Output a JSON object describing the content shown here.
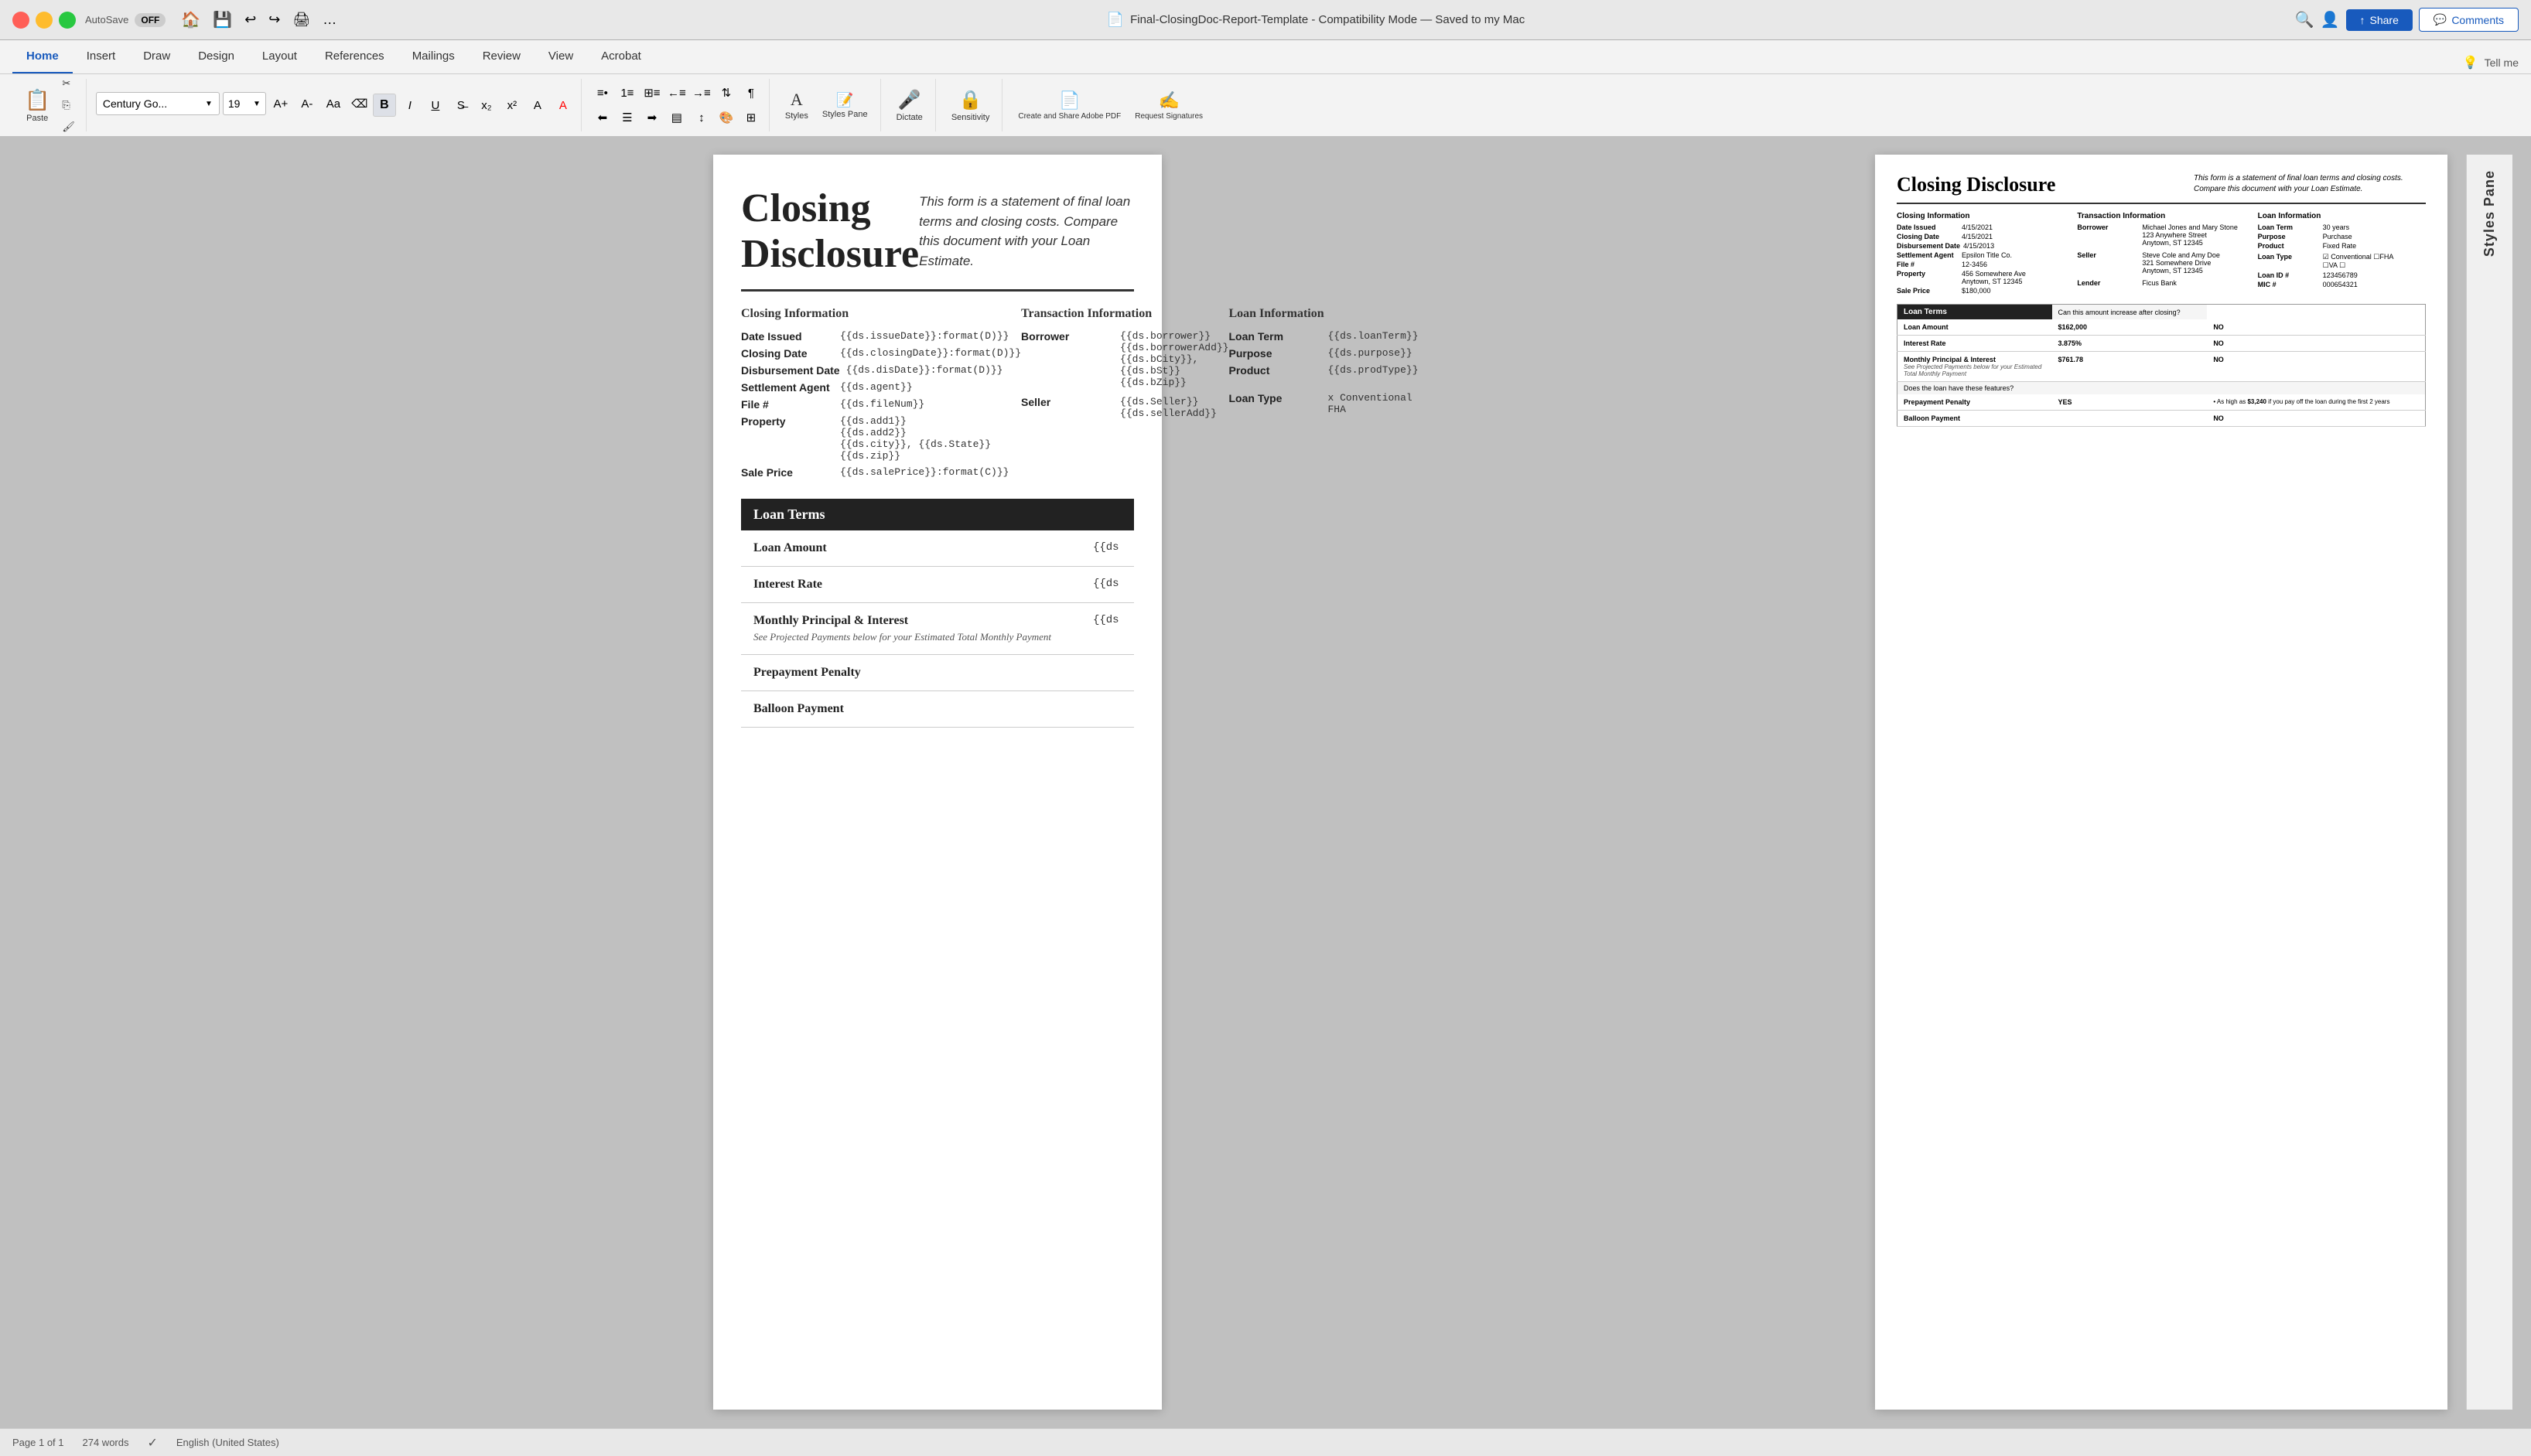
{
  "app": {
    "title": "Final-ClosingDoc-Report-Template",
    "mode": "Compatibility Mode",
    "save_status": "Saved to my Mac"
  },
  "titlebar": {
    "autosave_label": "AutoSave",
    "autosave_state": "OFF",
    "title": "Final-ClosingDoc-Report-Template  -  Compatibility Mode  —  Saved to my Mac"
  },
  "ribbon": {
    "tabs": [
      "Home",
      "Insert",
      "Draw",
      "Design",
      "Layout",
      "References",
      "Mailings",
      "Review",
      "View",
      "Acrobat"
    ],
    "active_tab": "Home",
    "font_name": "Century Go...",
    "font_size": "19",
    "share_label": "Share",
    "comments_label": "Comments",
    "tell_me": "Tell me",
    "buttons": {
      "paste": "Paste",
      "styles": "Styles",
      "styles_pane": "Styles Pane",
      "dictate": "Dictate",
      "sensitivity": "Sensitivity",
      "create_share_pdf": "Create and Share Adobe PDF",
      "request_signatures": "Request Signatures"
    }
  },
  "document": {
    "main_title": "Closing Disclosure",
    "subtitle": "This form is a statement of final loan terms and closing costs. Compare this document with your Loan Estimate.",
    "closing_info": {
      "title": "Closing Information",
      "rows": [
        {
          "label": "Date Issued",
          "value": "{{ds.issueDate}}:format(D)}}"
        },
        {
          "label": "Closing Date",
          "value": "{{ds.closingDate}}:format(D)}}"
        },
        {
          "label": "Disbursement Date",
          "value": "{{ds.disDate}}:format(D)}}"
        },
        {
          "label": "Settlement Agent",
          "value": "{{ds.agent}}"
        },
        {
          "label": "File #",
          "value": "{{ds.fileNum}}"
        },
        {
          "label": "Property",
          "value": "{{ds.add1}}\n{{ds.add2}}\n{{ds.city}}, {{ds.State}}\n{{ds.zip}}"
        },
        {
          "label": "Sale Price",
          "value": "{{ds.salePrice}}:format(C)}}"
        }
      ]
    },
    "transaction_info": {
      "title": "Transaction Information",
      "rows": [
        {
          "label": "Borrower",
          "value": "{{ds.borrower}}\n{{ds.borrowerAdd}}\n{{ds.bCity}}, {{ds.bSt}} {{ds.bZip}}"
        },
        {
          "label": "Seller",
          "value": "{{ds.Seller}}\n{{ds.sellerAdd}}"
        }
      ]
    },
    "loan_info": {
      "title": "Loan  Information",
      "rows": [
        {
          "label": "Loan Term",
          "value": "{{ds.loanTerm}}"
        },
        {
          "label": "Purpose",
          "value": "{{ds.purpose}}"
        },
        {
          "label": "Product",
          "value": "{{ds.prodType}}"
        },
        {
          "label": "Loan Type",
          "value": "x  Conventional    FHA"
        }
      ]
    },
    "loan_terms": {
      "title": "Loan Terms",
      "can_increase_label": "Can this amount increase after closing?",
      "rows": [
        {
          "label": "Loan Amount",
          "value": "{{ds",
          "answer": ""
        },
        {
          "label": "Interest Rate",
          "value": "{{ds",
          "answer": ""
        },
        {
          "label": "Monthly Principal & Interest",
          "value": "{{ds",
          "answer": "",
          "sub": "See Projected Payments below for your Estimated Total Monthly Payment"
        },
        {
          "label": "Prepayment Penalty",
          "value": "",
          "answer": ""
        },
        {
          "label": "Balloon Payment",
          "value": "",
          "answer": ""
        }
      ]
    }
  },
  "preview": {
    "main_title": "Closing Disclosure",
    "subtitle": "This form is a statement of final loan terms and closing costs. Compare this document with your Loan Estimate.",
    "closing_info": {
      "title": "Closing Information",
      "rows": [
        {
          "label": "Date Issued",
          "value": "4/15/2021"
        },
        {
          "label": "Closing Date",
          "value": "4/15/2021"
        },
        {
          "label": "Disbursement Date",
          "value": "4/15/2013"
        },
        {
          "label": "Settlement Agent",
          "value": "Epsilon Title Co."
        },
        {
          "label": "File #",
          "value": "12-3456"
        },
        {
          "label": "Property",
          "value": "456 Somewhere Ave\nAnytown, ST 12345"
        },
        {
          "label": "Sale Price",
          "value": "$180,000"
        }
      ]
    },
    "transaction_info": {
      "title": "Transaction Information",
      "rows": [
        {
          "label": "Borrower",
          "value": "Michael Jones and Mary Stone\n123 Anywhere Street\nAnytown, ST 12345"
        },
        {
          "label": "Seller",
          "value": "Steve Cole and Amy Doe\n321 Somewhere Drive\nAnytown, ST 12345"
        },
        {
          "label": "Lender",
          "value": "Ficus Bank"
        }
      ]
    },
    "loan_info": {
      "title": "Loan  Information",
      "rows": [
        {
          "label": "Loan Term",
          "value": "30 years"
        },
        {
          "label": "Purpose",
          "value": "Purchase"
        },
        {
          "label": "Product",
          "value": "Fixed Rate"
        },
        {
          "label": "Loan Type",
          "value": "☑ Conventional  ☐FHA\n☐VA  ☐"
        },
        {
          "label": "Loan ID #",
          "value": "123456789"
        },
        {
          "label": "MIC #",
          "value": "000654321"
        }
      ]
    },
    "loan_terms": {
      "title": "Loan Terms",
      "can_increase_label": "Can this amount increase after closing?",
      "rows": [
        {
          "label": "Loan Amount",
          "value": "$162,000",
          "answer": "NO"
        },
        {
          "label": "Interest Rate",
          "value": "3.875%",
          "answer": "NO"
        },
        {
          "label": "Monthly Principal & Interest",
          "value": "$761.78",
          "answer": "NO",
          "sub": "See Projected Payments below for your Estimated Total Monthly Payment"
        },
        {
          "label": "Prepayment Penalty",
          "value": "",
          "answer": "YES",
          "sub2": "• As high as $3,240 if you pay off the loan during the first 2 years"
        },
        {
          "label": "Balloon Payment",
          "value": "",
          "answer": "NO"
        }
      ],
      "does_loan_label": "Does the loan have these features?"
    }
  },
  "styles_pane": {
    "title": "Styles Pane"
  },
  "statusbar": {
    "page_info": "Page 1 of 1",
    "words": "274 words",
    "language": "English (United States)"
  }
}
